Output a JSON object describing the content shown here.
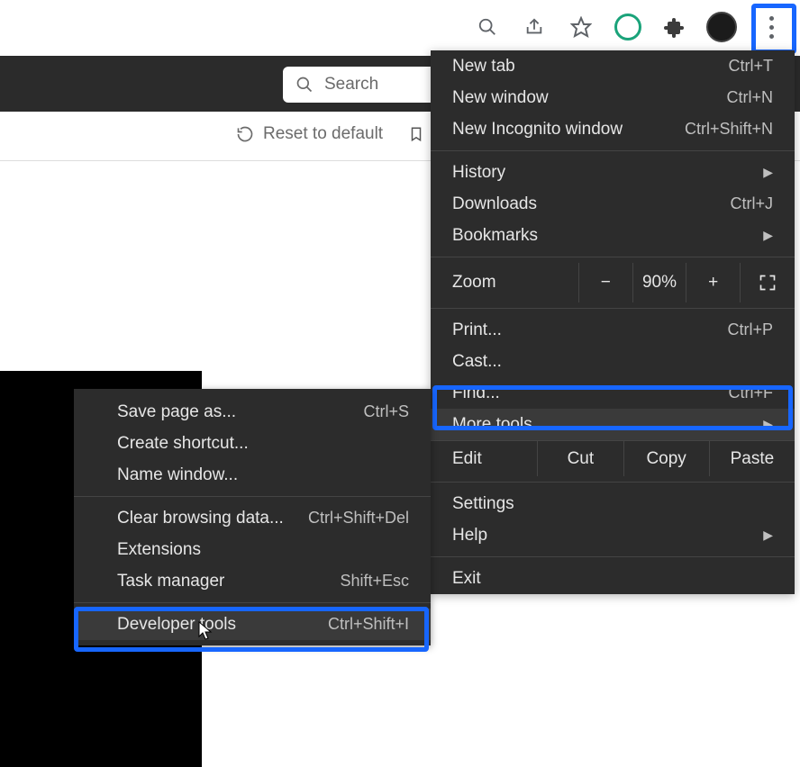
{
  "toolbar": {
    "icons": {
      "zoom": "zoom-icon",
      "share": "share-icon",
      "star": "star-icon",
      "grammarly": "grammarly-icon",
      "extensions": "puzzle-icon",
      "avatar": "avatar-icon",
      "menu": "menu-icon"
    }
  },
  "page": {
    "search_placeholder": "Search",
    "reset_label": "Reset to default"
  },
  "main_menu": {
    "new_tab": "New tab",
    "new_tab_sc": "Ctrl+T",
    "new_window": "New window",
    "new_window_sc": "Ctrl+N",
    "new_incognito": "New Incognito window",
    "new_incognito_sc": "Ctrl+Shift+N",
    "history": "History",
    "downloads": "Downloads",
    "downloads_sc": "Ctrl+J",
    "bookmarks": "Bookmarks",
    "zoom_label": "Zoom",
    "zoom_minus": "−",
    "zoom_value": "90%",
    "zoom_plus": "+",
    "print": "Print...",
    "print_sc": "Ctrl+P",
    "cast": "Cast...",
    "find": "Find...",
    "find_sc": "Ctrl+F",
    "more_tools": "More tools",
    "edit": "Edit",
    "cut": "Cut",
    "copy": "Copy",
    "paste": "Paste",
    "settings": "Settings",
    "help": "Help",
    "exit": "Exit"
  },
  "sub_menu": {
    "save_page": "Save page as...",
    "save_page_sc": "Ctrl+S",
    "create_shortcut": "Create shortcut...",
    "name_window": "Name window...",
    "clear_data": "Clear browsing data...",
    "clear_data_sc": "Ctrl+Shift+Del",
    "extensions": "Extensions",
    "task_manager": "Task manager",
    "task_manager_sc": "Shift+Esc",
    "dev_tools": "Developer tools",
    "dev_tools_sc": "Ctrl+Shift+I"
  },
  "highlight_color": "#1766ff"
}
